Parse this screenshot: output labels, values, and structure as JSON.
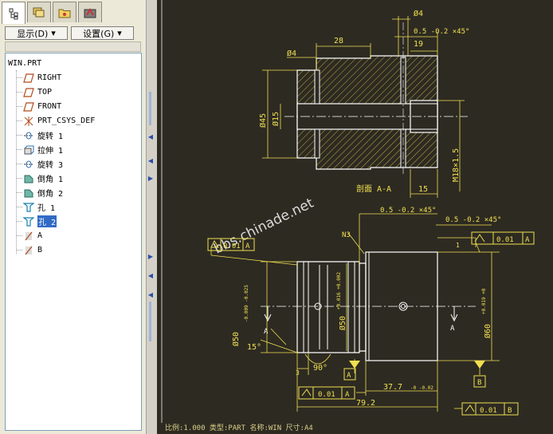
{
  "sidebar": {
    "tabs": [
      {
        "name": "model-tree-tab-icon"
      },
      {
        "name": "layers-tab-icon"
      },
      {
        "name": "folder-tab-icon"
      },
      {
        "name": "favorites-tab-icon"
      }
    ],
    "show_label": "显示(D)",
    "settings_label": "设置(G)",
    "root": "WIN.PRT",
    "items": [
      {
        "label": "RIGHT",
        "icon": "datum-plane-icon"
      },
      {
        "label": "TOP",
        "icon": "datum-plane-icon"
      },
      {
        "label": "FRONT",
        "icon": "datum-plane-icon"
      },
      {
        "label": "PRT_CSYS_DEF",
        "icon": "csys-icon"
      },
      {
        "label": "旋转 1",
        "icon": "revolve-icon"
      },
      {
        "label": "拉伸 1",
        "icon": "extrude-icon"
      },
      {
        "label": "旋转 3",
        "icon": "revolve-icon"
      },
      {
        "label": "倒角 1",
        "icon": "chamfer-icon"
      },
      {
        "label": "倒角 2",
        "icon": "chamfer-icon"
      },
      {
        "label": "孔 1",
        "icon": "hole-icon"
      },
      {
        "label": "孔 2",
        "icon": "hole-icon"
      },
      {
        "label": "A",
        "icon": "datum-axis-icon"
      },
      {
        "label": "B",
        "icon": "datum-axis-icon"
      }
    ],
    "selected_item": "孔 2"
  },
  "drawing": {
    "section_label": "剖面 A-A",
    "watermark": "bbs.chinade.net",
    "dims": {
      "d_phi4": "Ø4",
      "chamfer_top": "0.5 -0.2 ×45°",
      "d_28": "28",
      "d_phi4b": "Ø4",
      "d_19": "19",
      "d_phi45": "Ø45",
      "d_phi15": "Ø15",
      "d_m18": "M18×1.5",
      "d_15": "15",
      "chamfer_b1": "0.5 -0.2 ×45°",
      "chamfer_b2": "0.5 -0.2 ×45°",
      "n3": "N3",
      "gtol_left": "0.01",
      "gtol_left_ref": "A",
      "gtol_right": "0.01",
      "gtol_right_ref": "A",
      "d_phi50a": "Ø50",
      "d_phi50a_tol": "-0.009 -0.025",
      "d_phi50b": "Ø50",
      "d_phi50b_tol": "+0.016 +0.002",
      "d_phi60": "Ø60",
      "d_phi60_tol": "+0.019 +0",
      "ang_15": "15°",
      "ang_90": "90°",
      "d_3": "3",
      "datum_a": "A",
      "gtol_bottom": "0.01",
      "gtol_bottom_ref": "A",
      "d_377": "37.7",
      "d_377_tol": "-0 -0.02",
      "d_792": "79.2",
      "datum_b": "B",
      "gtol_b": "0.01",
      "gtol_b_ref": "B",
      "sec_a_left": "A",
      "sec_a_right": "A",
      "surf_1": "1"
    }
  },
  "status": {
    "text": "比例:1.000   类型:PART   名称:WIN   尺寸:A4"
  }
}
